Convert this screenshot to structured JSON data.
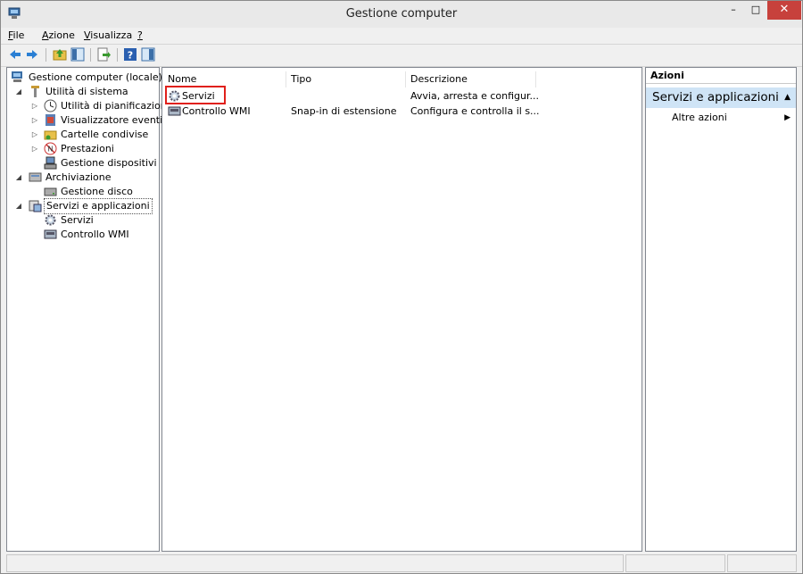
{
  "window": {
    "title": "Gestione computer"
  },
  "titlebar": {
    "minimize_glyph": "–",
    "maximize_glyph": "□",
    "close_glyph": "✕"
  },
  "menu": [
    {
      "label": "File",
      "accel": "F",
      "rest": "ile"
    },
    {
      "label": "Azione",
      "accel": "A",
      "rest": "zione"
    },
    {
      "label": "Visualizza",
      "accel": "V",
      "rest": "isualizza"
    },
    {
      "label": "?",
      "accel": "?",
      "rest": ""
    }
  ],
  "toolbar": {
    "icons": [
      "back-arrow-icon",
      "forward-arrow-icon",
      "up-folder-icon",
      "show-hide-tree-icon",
      "export-list-icon",
      "help-icon",
      "show-hide-action-pane-icon"
    ]
  },
  "tree": {
    "root": "Gestione computer (locale)",
    "system_tools": "Utilità di sistema",
    "task_scheduler": "Utilità di pianificazione",
    "event_viewer": "Visualizzatore eventi",
    "shared_folders": "Cartelle condivise",
    "performance": "Prestazioni",
    "device_manager": "Gestione dispositivi",
    "storage": "Archiviazione",
    "disk_management": "Gestione disco",
    "services_apps": "Servizi e applicazioni",
    "services": "Servizi",
    "wmi": "Controllo WMI",
    "expand_glyph": "▷",
    "collapse_glyph": "◢"
  },
  "list": {
    "columns": [
      "Nome",
      "Tipo",
      "Descrizione"
    ],
    "rows": [
      {
        "name": "Servizi",
        "type": "",
        "description": "Avvia, arresta e configur..."
      },
      {
        "name": "Controllo WMI",
        "type": "Snap-in di estensione",
        "description": "Configura e controlla il s..."
      }
    ]
  },
  "actions": {
    "header": "Azioni",
    "section": "Servizi e applicazioni",
    "section_arrow": "▲",
    "more": "Altre azioni",
    "more_arrow": "▶"
  },
  "colors": {
    "selection": "#cfe4f6",
    "close_button": "#c7413c",
    "highlight_box": "#e0201b"
  }
}
